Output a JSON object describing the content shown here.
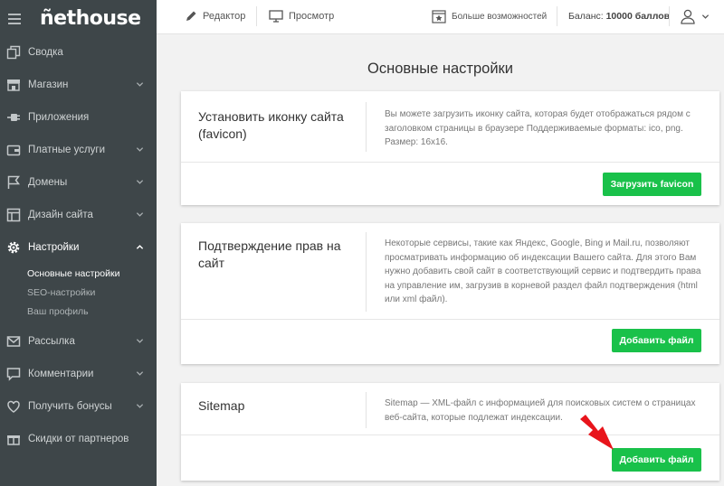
{
  "sidebar": {
    "logo": "ñethouse",
    "items": [
      {
        "label": "Сводка",
        "icon": "copy-icon",
        "chevron": false
      },
      {
        "label": "Магазин",
        "icon": "store-icon",
        "chevron": true
      },
      {
        "label": "Приложения",
        "icon": "plug-icon",
        "chevron": false
      },
      {
        "label": "Платные услуги",
        "icon": "wallet-icon",
        "chevron": true
      },
      {
        "label": "Домены",
        "icon": "flag-icon",
        "chevron": true
      },
      {
        "label": "Дизайн сайта",
        "icon": "layout-icon",
        "chevron": true
      },
      {
        "label": "Настройки",
        "icon": "gear-icon",
        "chevron": true,
        "active": true
      },
      {
        "label": "Рассылка",
        "icon": "mail-icon",
        "chevron": true
      },
      {
        "label": "Комментарии",
        "icon": "comment-icon",
        "chevron": true
      },
      {
        "label": "Получить бонусы",
        "icon": "heart-icon",
        "chevron": true
      },
      {
        "label": "Скидки от партнеров",
        "icon": "gift-icon",
        "chevron": false
      }
    ],
    "subitems": [
      {
        "label": "Основные настройки",
        "active": true
      },
      {
        "label": "SEO-настройки"
      },
      {
        "label": "Ваш профиль"
      }
    ]
  },
  "topbar": {
    "editor": "Редактор",
    "preview": "Просмотр",
    "more": "Больше возможностей",
    "balance_prefix": "Баланс:",
    "balance_value": "10000 баллов"
  },
  "main": {
    "title": "Основные настройки",
    "cards": [
      {
        "title": "Установить иконку сайта (favicon)",
        "description": "Вы можете загрузить иконку сайта, которая будет отображаться рядом с заголовком страницы в браузере Поддерживаемые форматы: ico, png. Размер: 16х16.",
        "button": "Загрузить favicon"
      },
      {
        "title": "Подтверждение прав на сайт",
        "description": "Некоторые сервисы, такие как Яндекс, Google, Bing и Mail.ru, позволяют просматривать информацию об индексации Вашего сайта. Для этого Вам нужно добавить свой сайт в соответствующий сервис и подтвердить права на управление им, загрузив в корневой раздел файл подтверждения (html или xml файл).",
        "button": "Добавить файл"
      },
      {
        "title": "Sitemap",
        "description": "Sitemap — XML-файл с информацией для поисковых систем о страницах веб-сайта, которые подлежат индексации.",
        "button": "Добавить файл"
      }
    ]
  },
  "colors": {
    "sidebar_bg": "#3e4649",
    "accent_green": "#19c14a",
    "arrow_red": "#e8141b"
  }
}
